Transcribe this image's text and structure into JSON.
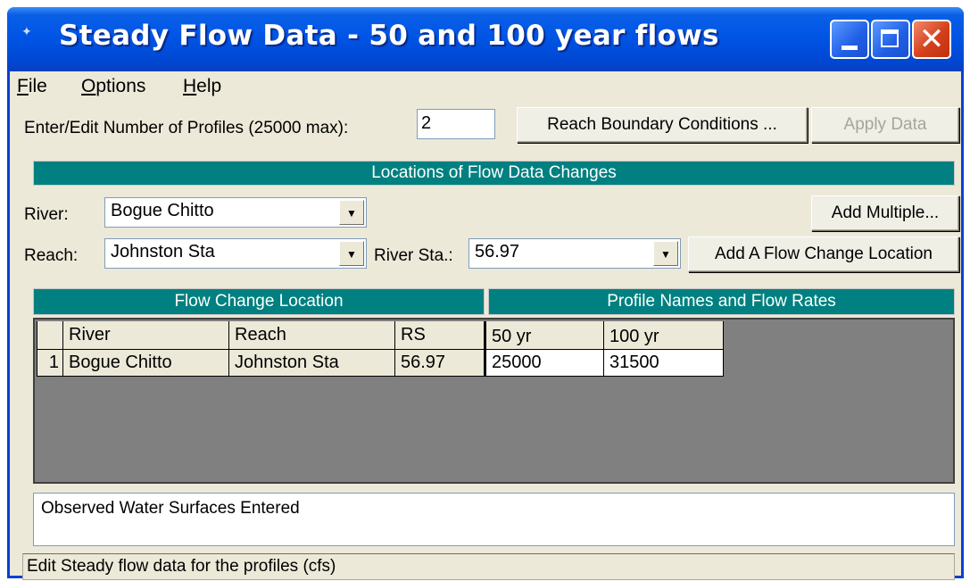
{
  "window": {
    "title": "Steady Flow Data - 50 and 100 year flows"
  },
  "menu": [
    {
      "label": "File",
      "accel": "F",
      "rest": "ile"
    },
    {
      "label": "Options",
      "accel": "O",
      "rest": "ptions"
    },
    {
      "label": "Help",
      "accel": "H",
      "rest": "elp"
    }
  ],
  "profiles": {
    "label": "Enter/Edit Number of Profiles (25000 max):",
    "value": "2",
    "reach_boundary_button": "Reach Boundary Conditions ...",
    "apply_button": "Apply Data"
  },
  "locations": {
    "header": "Locations of Flow Data Changes",
    "river_label": "River:",
    "river_value": "Bogue Chitto",
    "reach_label": "Reach:",
    "reach_value": "Johnston Sta",
    "river_sta_label": "River Sta.:",
    "river_sta_value": "56.97",
    "add_multiple_button": "Add Multiple...",
    "add_location_button": "Add A Flow Change Location"
  },
  "table": {
    "group_headers": {
      "location": "Flow Change Location",
      "profiles": "Profile Names and Flow Rates"
    },
    "columns": [
      "River",
      "Reach",
      "RS",
      "50 yr",
      "100 yr"
    ],
    "rows": [
      {
        "num": "1",
        "river": "Bogue Chitto",
        "reach": "Johnston Sta",
        "rs": "56.97",
        "flow_50": "25000",
        "flow_100": "31500"
      }
    ]
  },
  "notes": "Observed Water Surfaces Entered",
  "status": "Edit Steady flow data for the profiles (cfs)",
  "colors": {
    "titlebar": "#0055e5",
    "header_teal": "#008080",
    "window_bg": "#ece9d8",
    "grid_bg": "#808080"
  }
}
